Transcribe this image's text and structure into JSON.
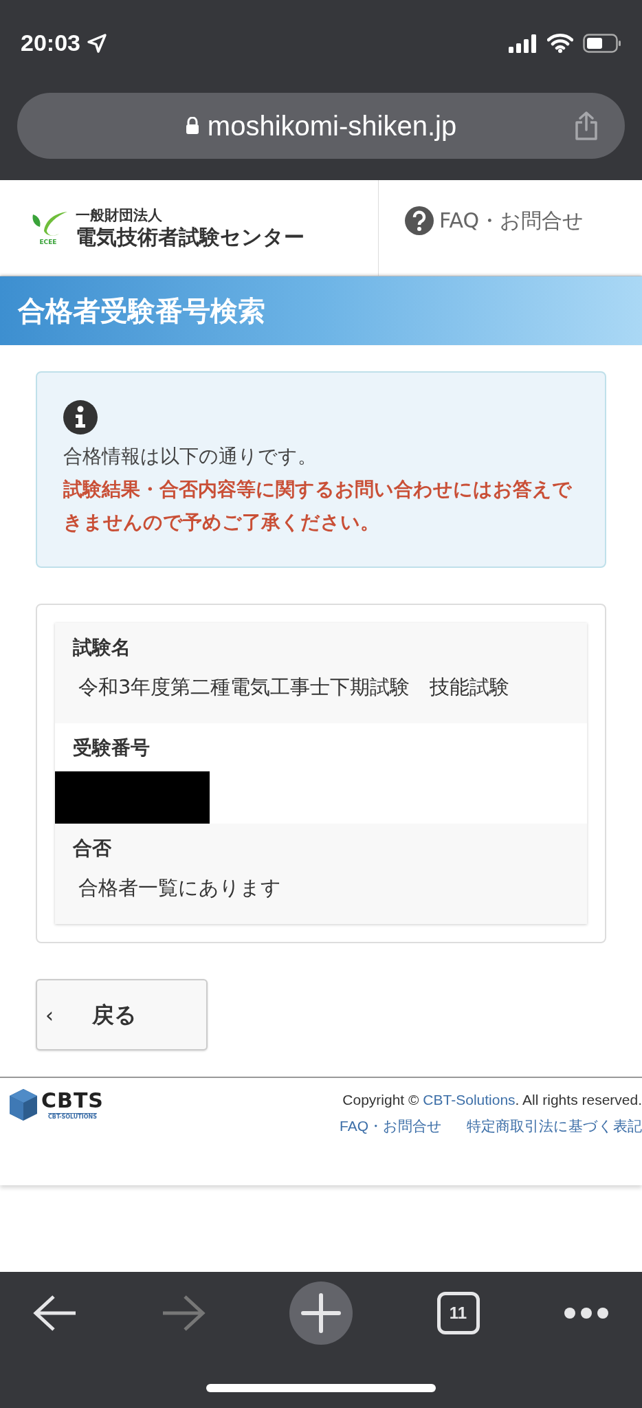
{
  "status_bar": {
    "time": "20:03"
  },
  "address_bar": {
    "url": "moshikomi-shiken.jp"
  },
  "header": {
    "logo_small": "ECEE",
    "org_type": "一般財団法人",
    "org_name": "電気技術者試験センター",
    "faq_link": "FAQ・お問合せ"
  },
  "page_title": "合格者受験番号検索",
  "notice": {
    "message": "合格情報は以下の通りです。",
    "warning": "試験結果・合否内容等に関するお問い合わせにはお答えできませんので予めご了承ください。"
  },
  "result_rows": [
    {
      "label": "試験名",
      "value": "令和3年度第二種電気工事士下期試験　技能試験",
      "redacted": false
    },
    {
      "label": "受験番号",
      "redacted": true
    },
    {
      "label": "合否",
      "value": "合格者一覧にあります",
      "redacted": false
    }
  ],
  "back_button": {
    "arrow": "‹",
    "label": "戻る"
  },
  "footer": {
    "logo_text": "CBTS",
    "logo_sub": "CBT-SOLUTIONS",
    "copyright_prefix": "Copyright © ",
    "copyright_link": "CBT-Solutions",
    "copyright_suffix": ". All rights reserved.",
    "links": [
      "FAQ・お問合せ",
      "特定商取引法に基づく表記"
    ]
  },
  "toolbar": {
    "back_disabled": false,
    "forward_disabled": true,
    "tab_count": "11"
  }
}
